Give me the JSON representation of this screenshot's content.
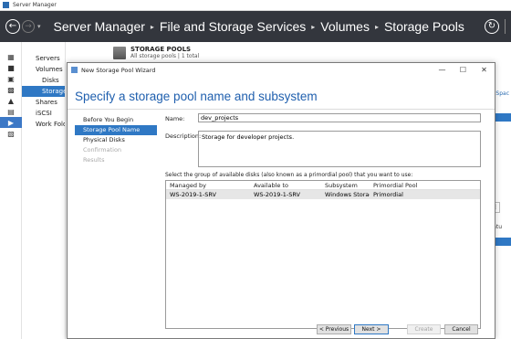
{
  "app": {
    "title": "Server Manager"
  },
  "header": {
    "breadcrumb": [
      "Server Manager",
      "File and Storage Services",
      "Volumes",
      "Storage Pools"
    ]
  },
  "nav": {
    "items": [
      {
        "label": "Servers",
        "sub": false,
        "active": false
      },
      {
        "label": "Volumes",
        "sub": false,
        "active": false
      },
      {
        "label": "Disks",
        "sub": true,
        "active": false
      },
      {
        "label": "Storage Pools",
        "sub": true,
        "active": true
      },
      {
        "label": "Shares",
        "sub": false,
        "active": false
      },
      {
        "label": "iSCSI",
        "sub": false,
        "active": false
      },
      {
        "label": "Work Folders",
        "sub": false,
        "active": false
      }
    ]
  },
  "main": {
    "pool_title": "STORAGE POOLS",
    "pool_subtitle": "All storage pools | 1 total",
    "side_link": "Free Spac",
    "side_status": "Statu"
  },
  "wizard": {
    "title": "New Storage Pool Wizard",
    "heading": "Specify a storage pool name and subsystem",
    "steps": [
      {
        "label": "Before You Begin",
        "state": "normal"
      },
      {
        "label": "Storage Pool Name",
        "state": "active"
      },
      {
        "label": "Physical Disks",
        "state": "normal"
      },
      {
        "label": "Confirmation",
        "state": "disabled"
      },
      {
        "label": "Results",
        "state": "disabled"
      }
    ],
    "name_label": "Name:",
    "name_value": "dev_projects",
    "description_label": "Description:",
    "description_value": "Storage for developer projects.",
    "select_label": "Select the group of available disks (also known as a primordial pool) that you want to use:",
    "table": {
      "columns": [
        "Managed by",
        "Available to",
        "Subsystem",
        "Primordial Pool"
      ],
      "rows": [
        [
          "WS-2019-1-SRV",
          "WS-2019-1-SRV",
          "Windows Storage",
          "Primordial"
        ]
      ]
    },
    "buttons": {
      "previous": "< Previous",
      "next": "Next >",
      "create": "Create",
      "cancel": "Cancel"
    }
  },
  "colors": {
    "header_bg": "#33363d",
    "accent": "#2f78c4",
    "heading": "#1f5fae"
  }
}
